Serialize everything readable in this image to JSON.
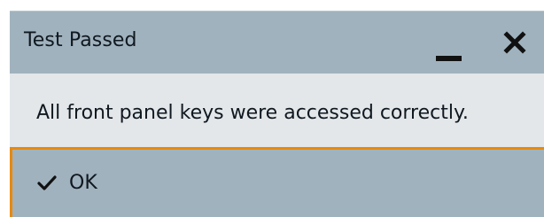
{
  "dialog": {
    "title": "Test Passed",
    "minimize_icon": "minimize-icon",
    "close_icon": "close-icon",
    "message": "All front panel keys were accessed correctly.",
    "ok_button": {
      "label": "OK",
      "icon": "checkmark-icon"
    }
  },
  "colors": {
    "titlebar": "#a0b2be",
    "body": "#e3e7ea",
    "focus_accent": "#e8890c",
    "text": "#101820"
  }
}
